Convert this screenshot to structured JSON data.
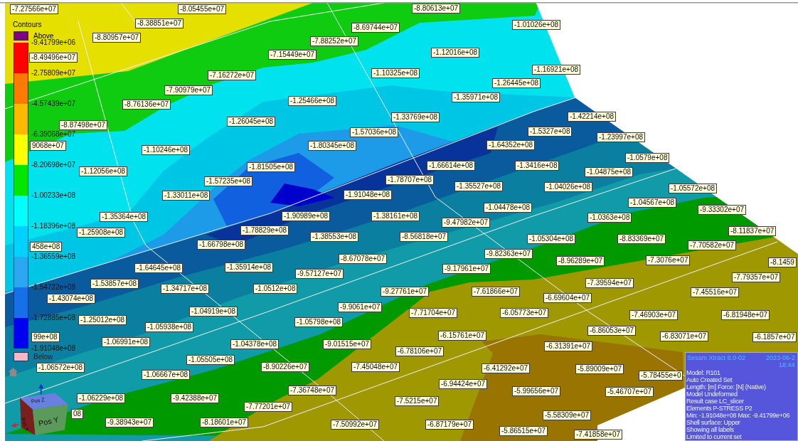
{
  "legend": {
    "title": "Contours",
    "above": {
      "label": "Above",
      "color": "#800080"
    },
    "below": {
      "label": "Below",
      "color": "#f4b6c8"
    },
    "bands": [
      {
        "color": "#ff0000"
      },
      {
        "color": "#ff7a00"
      },
      {
        "color": "#ffb800"
      },
      {
        "color": "#ffff00"
      },
      {
        "color": "#00e600"
      },
      {
        "color": "#00ffff"
      },
      {
        "color": "#00d2ff"
      },
      {
        "color": "#29a8f0"
      },
      {
        "color": "#1670e8"
      },
      {
        "color": "#0000f0"
      }
    ],
    "ticks": [
      "-9.41799e+06",
      "-2.75809e+07",
      "-4.57439e+07",
      "-6.39068e+07",
      "-8.20698e+07",
      "-1.00233e+08",
      "-1.18396e+08",
      "-1.36559e+08",
      "-1.54722e+08",
      "-1.72885e+08",
      "-1.91048e+08"
    ]
  },
  "node_labels": [
    "-7.27566e+07",
    "-8.05455e+07",
    "-8.80613e+07",
    "-8.38851e+07",
    "-8.69744e+07",
    "-1.01026e+08",
    "-8.80957e+07",
    "-7.88252e+07",
    "-8.49496e+07",
    "-7.15449e+07",
    "-1.12016e+08",
    "-1.16921e+08",
    "-7.16272e+07",
    "-1.10325e+08",
    "-1.26445e+08",
    "-7.90979e+07",
    "-8.76136e+07",
    "-1.25466e+08",
    "-1.35971e+08",
    "-1.42214e+08",
    "-1.33769e+08",
    "-8.87498e+07",
    "-1.26045e+08",
    "-1.5327e+08",
    "-1.57036e+08",
    "-1.23997e+08",
    "9068e+07",
    "-1.80345e+08",
    "-1.64352e+08",
    "-1.10246e+08",
    "-1.0579e+08",
    "-1.81505e+08",
    "-1.66614e+08",
    "-1.3416e+08",
    "-1.12056e+08",
    "-1.04875e+08",
    "-1.57235e+08",
    "-1.78707e+08",
    "-1.35527e+08",
    "-1.04026e+08",
    "-1.05572e+08",
    "-1.91048e+08",
    "-1.33011e+08",
    "-1.04567e+08",
    "-1.04478e+08",
    "-9.33302e+07",
    "-1.35364e+08",
    "-1.90989e+08",
    "-1.38161e+08",
    "-1.0363e+08",
    "-9.47982e+07",
    "-1.25908e+08",
    "-1.78829e+08",
    "-8.11837e+07",
    "-1.38553e+08",
    "-8.56818e+07",
    "-1.05304e+08",
    "-8.83369e+07",
    "458e+08",
    "-1.66798e+08",
    "-7.70582e+07",
    "-9.82363e+07",
    "-8.67078e+07",
    "-8.96289e+07",
    "-7.3076e+07",
    "-1.64645e+08",
    "-1.35914e+08",
    "-9.17961e+07",
    "-8.1459",
    "-9.57127e+07",
    "-7.79357e+07",
    "-7.39594e+07",
    "-1.53857e+08",
    "-1.34717e+08",
    "-1.0512e+08",
    "-9.27761e+07",
    "-7.61866e+07",
    "-7.45516e+07",
    "-1.43074e+08",
    "-6.69604e+07",
    "-9.9061e+07",
    "-1.04919e+08",
    "-7.71704e+07",
    "-6.05773e+07",
    "-7.46903e+07",
    "-6.81948e+07",
    "-1.25012e+08",
    "-1.05798e+08",
    "-1.05938e+08",
    "99e+08",
    "-6.15761e+07",
    "-6.86053e+07",
    "-6.83071e+07",
    "-6.1857e+07",
    "-1.06991e+08",
    "-1.04378e+08",
    "-9.01515e+07",
    "-6.31391e+07",
    "-6.78106e+07",
    "-1.06572e+08",
    "-1.05505e+08",
    "-8.90226e+07",
    "-7.45048e+07",
    "-6.41292e+07",
    "-5.89009e+07",
    "-5.78455e+0",
    "-1.06667e+08",
    "-6.94424e+07",
    "-7.36748e+07",
    "-5.99656e+07",
    "-5.46707e+07",
    "-1.06229e+08",
    "-9.42388e+07",
    "-7.77201e+07",
    "-7.5215e+07",
    "-5.58309e+07",
    "08",
    "-9.38943e+07",
    "-8.18601e+07",
    "-7.50992e+07",
    "-6.87179e+07",
    "-5.86515e+07",
    "-7.41858e+07"
  ],
  "view_cube": {
    "faces": [
      "Pos Z",
      "Pos X",
      "Pos Y"
    ]
  },
  "info_box": {
    "title": "Sesam Xtract 8.0-02",
    "date": "2023-06-2",
    "time": "18:44",
    "lines": [
      "Model: R101",
      "Auto Created Set",
      "Length: [m]  Force: [N] (Native)",
      "Model Undeformed",
      "Result case LC_slicer",
      "Elements P-STRESS P2",
      "Min: -1.91048e+08 Max: -9.41799e+06",
      "Shell surface: Upper",
      "Showing all labels",
      "Limited to current set"
    ]
  }
}
